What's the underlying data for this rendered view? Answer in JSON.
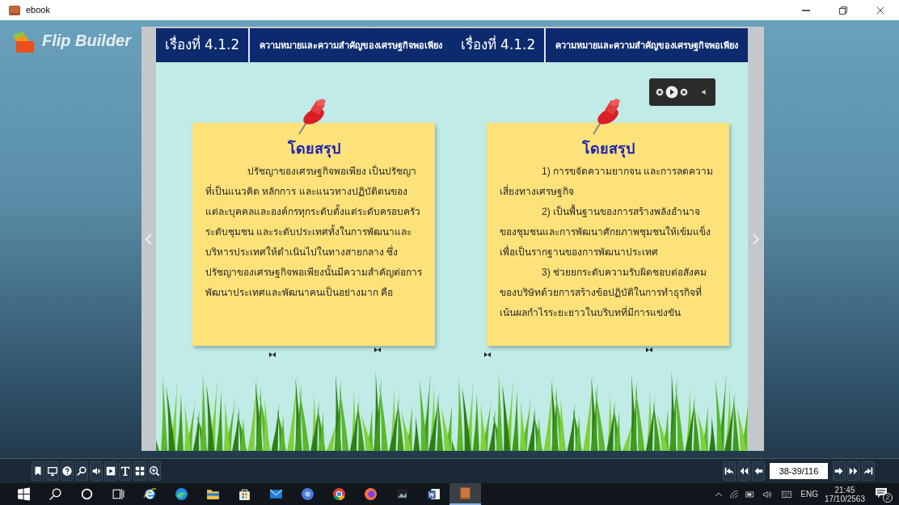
{
  "window": {
    "title": "ebook",
    "controls": [
      {
        "kind": "minimize"
      },
      {
        "kind": "restore"
      },
      {
        "kind": "close"
      }
    ]
  },
  "logo": {
    "text": "Flip Builder"
  },
  "pages": [
    {
      "header": {
        "label": "เรื่องที่ 4.1.2",
        "title": "ความหมายและความสำคัญของเศรษฐกิจพอเพียง"
      },
      "audio_player": false,
      "note": {
        "heading": "โดยสรุป",
        "paragraphs": [
          "ปรัชญาของเศรษฐกิจพอเพียง เป็นปรัชญาที่เป็นแนวคิด หลักการ และแนวทางปฏิบัติตนของแต่ละบุคคลและองค์กรทุกระดับตั้งแต่ระดับครอบครัว ระดับชุมชน และระดับประเทศทั้งในการพัฒนาและบริหารประเทศให้ดำเนินไปในทางสายกลาง  ซึ่งปรัชญาของเศรษฐกิจพอเพียงนั้นมีความสำคัญต่อการพัฒนาประเทศและพัฒนาคนเป็นอย่างมาก คือ"
        ]
      }
    },
    {
      "header": {
        "label": "เรื่องที่ 4.1.2",
        "title": "ความหมายและความสำคัญของเศรษฐกิจพอเพียง"
      },
      "audio_player": true,
      "note": {
        "heading": "โดยสรุป",
        "paragraphs": [
          "1) การขจัดความยากจน และการลดความเสี่ยงทางเศรษฐกิจ",
          "2) เป็นพื้นฐานของการสร้างพลังอำนาจของชุมชนและการพัฒนาศักยภาพชุมชนให้เข้มแข็งเพื่อเป็นรากฐานของการพัฒนาประเทศ",
          "3) ช่วยยกระดับความรับผิดชอบต่อสังคมของบริษัทด้วยการสร้างข้อปฏิบัติในการทำธุรกิจที่เน้นผลกำไรระยะยาวในบริบทที่มีการแข่งขัน"
        ]
      }
    }
  ],
  "toolbar": [
    {
      "kind": "bookmark"
    },
    {
      "kind": "thumbnails"
    },
    {
      "kind": "help"
    },
    {
      "kind": "search"
    },
    {
      "kind": "sound"
    },
    {
      "kind": "autoplay"
    },
    {
      "kind": "text"
    },
    {
      "kind": "grid"
    },
    {
      "kind": "zoom"
    }
  ],
  "navigation": {
    "buttons_before": [
      {
        "kind": "first"
      },
      {
        "kind": "fast-back"
      },
      {
        "kind": "back"
      }
    ],
    "page_field": "38-39/116",
    "buttons_after": [
      {
        "kind": "next"
      },
      {
        "kind": "fast-next"
      },
      {
        "kind": "last"
      }
    ]
  },
  "taskbar": {
    "apps": [
      {
        "kind": "start"
      },
      {
        "kind": "search"
      },
      {
        "kind": "cortana"
      },
      {
        "kind": "taskview"
      },
      {
        "kind": "ie"
      },
      {
        "kind": "edge"
      },
      {
        "kind": "folder"
      },
      {
        "kind": "store"
      },
      {
        "kind": "mail"
      },
      {
        "kind": "chromium"
      },
      {
        "kind": "chrome"
      },
      {
        "kind": "firefox"
      },
      {
        "kind": "photo-app"
      },
      {
        "kind": "word"
      },
      {
        "kind": "ebook"
      }
    ],
    "tray": {
      "language": "ENG",
      "time": "21:45",
      "date": "17/10/2563",
      "notifications": "2"
    }
  }
}
